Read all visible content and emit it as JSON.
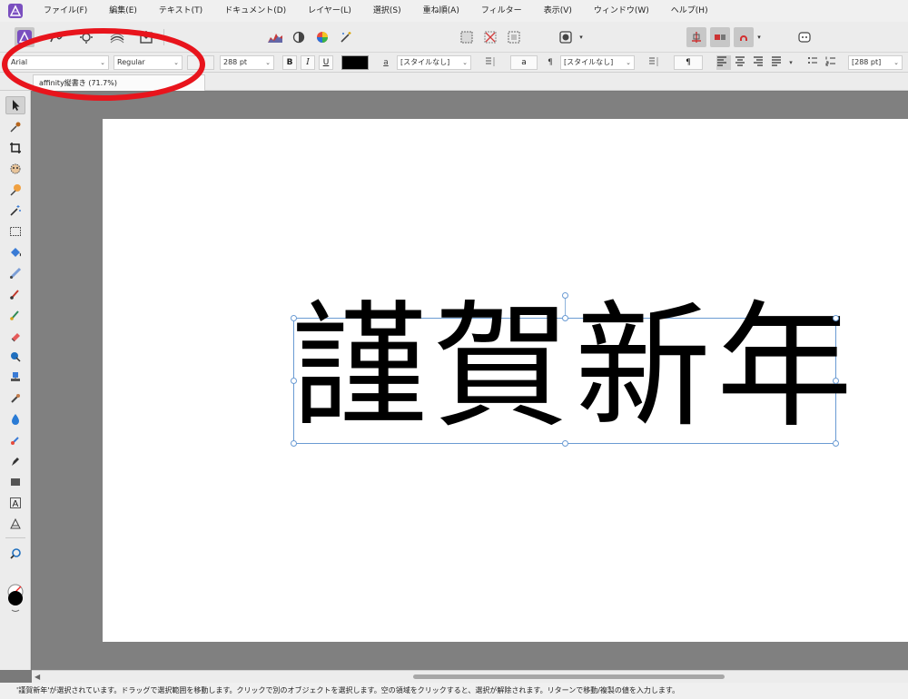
{
  "menu": {
    "items": [
      "ファイル(F)",
      "編集(E)",
      "テキスト(T)",
      "ドキュメント(D)",
      "レイヤー(L)",
      "選択(S)",
      "重ね順(A)",
      "フィルター",
      "表示(V)",
      "ウィンドウ(W)",
      "ヘルプ(H)"
    ]
  },
  "format_bar": {
    "font_family": "Arial",
    "font_style": "Regular",
    "font_size": "288 pt",
    "bold_label": "B",
    "italic_label": "I",
    "underline_label": "U",
    "text_color": "#000000",
    "char_style_glyph": "a",
    "char_style": "[スタイルなし]",
    "case_glyph": "a",
    "para_glyph": "¶",
    "para_style": "[スタイルなし]",
    "para_mark": "¶",
    "leading": "[288 pt]"
  },
  "document": {
    "tab_title": "affinity縦書き (71.7%)",
    "text": "謹賀新年"
  },
  "status_bar": {
    "message": "'謹賀新年'が選択されています。ドラッグで選択範囲を移動します。クリックで別のオブジェクトを選択します。空の領域をクリックすると、選択が解除されます。リターンで移動/複製の値を入力します。"
  },
  "colors": {
    "annotation": "#e8141c",
    "selection": "#6a9bd3",
    "accent": "#6b3fa0"
  }
}
